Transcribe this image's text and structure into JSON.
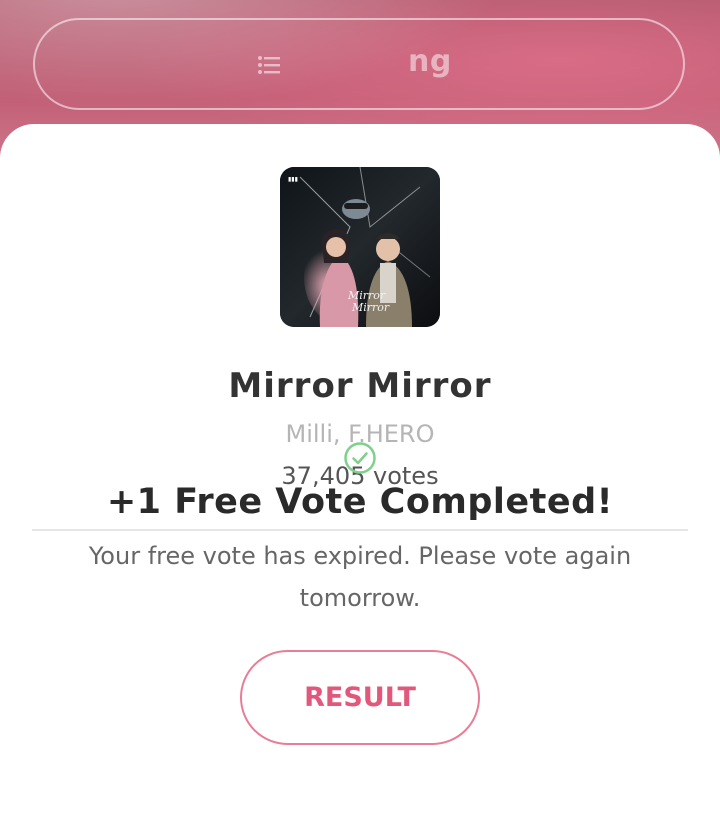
{
  "backdrop": {
    "button_label_fragment": "ng",
    "icon": "list-icon"
  },
  "song": {
    "title": "Mirror Mirror",
    "artist": "Milli, F.HERO",
    "votes": "37,405 votes",
    "cover_icon": "album-cover-image"
  },
  "result": {
    "icon": "check-circle-icon",
    "title": "+1 Free Vote Completed!",
    "message": "Your free vote has expired. Please vote again tomorrow.",
    "button_label": "RESULT"
  },
  "colors": {
    "accent": "#e2587a",
    "accent_border": "#e77d97",
    "check_green": "#7fd08a",
    "backdrop_pink": "#c25f76"
  }
}
